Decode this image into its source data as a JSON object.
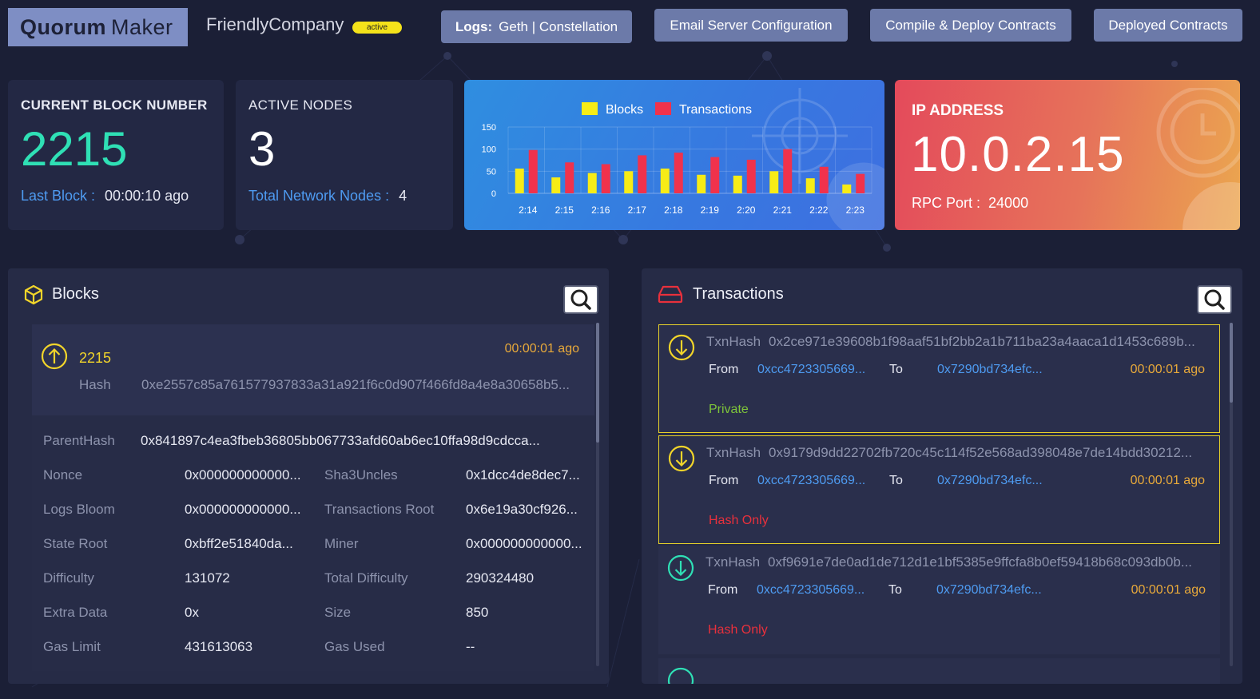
{
  "header": {
    "logo_bold": "Quorum",
    "logo_rest": "Maker",
    "company": "FriendlyCompany",
    "status_badge": "active",
    "buttons": {
      "logs_bold": "Logs:",
      "logs_rest": "Geth | Constellation",
      "email": "Email Server Configuration",
      "compile": "Compile & Deploy Contracts",
      "deployed": "Deployed Contracts"
    }
  },
  "cards": {
    "block": {
      "label": "CURRENT BLOCK NUMBER",
      "value": "2215",
      "sub_key": "Last Block :",
      "sub_value": "00:00:10 ago"
    },
    "nodes": {
      "label": "ACTIVE NODES",
      "value": "3",
      "sub_key": "Total Network Nodes :",
      "sub_value": "4"
    },
    "ip": {
      "label": "IP ADDRESS",
      "value": "10.0.2.15",
      "sub_key": "RPC Port :",
      "sub_value": "24000"
    }
  },
  "chart_data": {
    "type": "bar",
    "categories": [
      "2:14",
      "2:15",
      "2:16",
      "2:17",
      "2:18",
      "2:19",
      "2:20",
      "2:21",
      "2:22",
      "2:23"
    ],
    "series": [
      {
        "name": "Blocks",
        "color": "#f7ec16",
        "values": [
          56,
          36,
          46,
          50,
          56,
          42,
          40,
          50,
          34,
          20
        ]
      },
      {
        "name": "Transactions",
        "color": "#f0324c",
        "values": [
          98,
          70,
          66,
          86,
          92,
          82,
          76,
          100,
          60,
          44
        ]
      }
    ],
    "yticks": [
      0,
      50,
      100,
      150
    ],
    "ylim": [
      0,
      150
    ],
    "legend_position": "top-center"
  },
  "blocks_panel": {
    "title": "Blocks",
    "latest": {
      "number": "2215",
      "ago": "00:00:01 ago",
      "hash_label": "Hash",
      "hash": "0xe2557c85a761577937833a31a921f6c0d907f466fd8a4e8a30658b5..."
    },
    "parent_label": "ParentHash",
    "parent_value": "0x841897c4ea3fbeb36805bb067733afd60ab6ec10ffa98d9cdcca...",
    "details": [
      {
        "k1": "Nonce",
        "v1": "0x000000000000...",
        "k2": "Sha3Uncles",
        "v2": "0x1dcc4de8dec7..."
      },
      {
        "k1": "Logs Bloom",
        "v1": "0x000000000000...",
        "k2": "Transactions Root",
        "v2": "0x6e19a30cf926..."
      },
      {
        "k1": "State Root",
        "v1": "0xbff2e51840da...",
        "k2": "Miner",
        "v2": "0x000000000000..."
      },
      {
        "k1": "Difficulty",
        "v1": "131072",
        "k2": "Total Difficulty",
        "v2": "290324480"
      },
      {
        "k1": "Extra Data",
        "v1": "0x",
        "k2": "Size",
        "v2": "850"
      },
      {
        "k1": "Gas Limit",
        "v1": "431613063",
        "k2": "Gas Used",
        "v2": "--"
      }
    ]
  },
  "transactions_panel": {
    "title": "Transactions",
    "hash_label": "TxnHash",
    "from_label": "From",
    "to_label": "To",
    "items": [
      {
        "hash": "0x2ce971e39608b1f98aaf51bf2bb2a1b711ba23a4aaca1d1453c689b...",
        "from": "0xcc4723305669...",
        "to": "0x7290bd734efc...",
        "ago": "00:00:01 ago",
        "status": "Private",
        "status_color": "#7ec43a"
      },
      {
        "hash": "0x9179d9dd22702fb720c45c114f52e568ad398048e7de14bdd30212...",
        "from": "0xcc4723305669...",
        "to": "0x7290bd734efc...",
        "ago": "00:00:01 ago",
        "status": "Hash Only",
        "status_color": "#e8303c"
      },
      {
        "hash": "0xf9691e7de0ad1de712d1e1bf5385e9ffcfa8b0ef59418b68c093db0b...",
        "from": "0xcc4723305669...",
        "to": "0x7290bd734efc...",
        "ago": "00:00:01 ago",
        "status": "Hash Only",
        "status_color": "#e8303c"
      }
    ]
  },
  "colors": {
    "accent_green": "#2fe0b5",
    "accent_blue": "#4e9bf1",
    "accent_yellow": "#f2d52a",
    "accent_orange": "#e8a93a",
    "accent_red": "#e8303c"
  }
}
